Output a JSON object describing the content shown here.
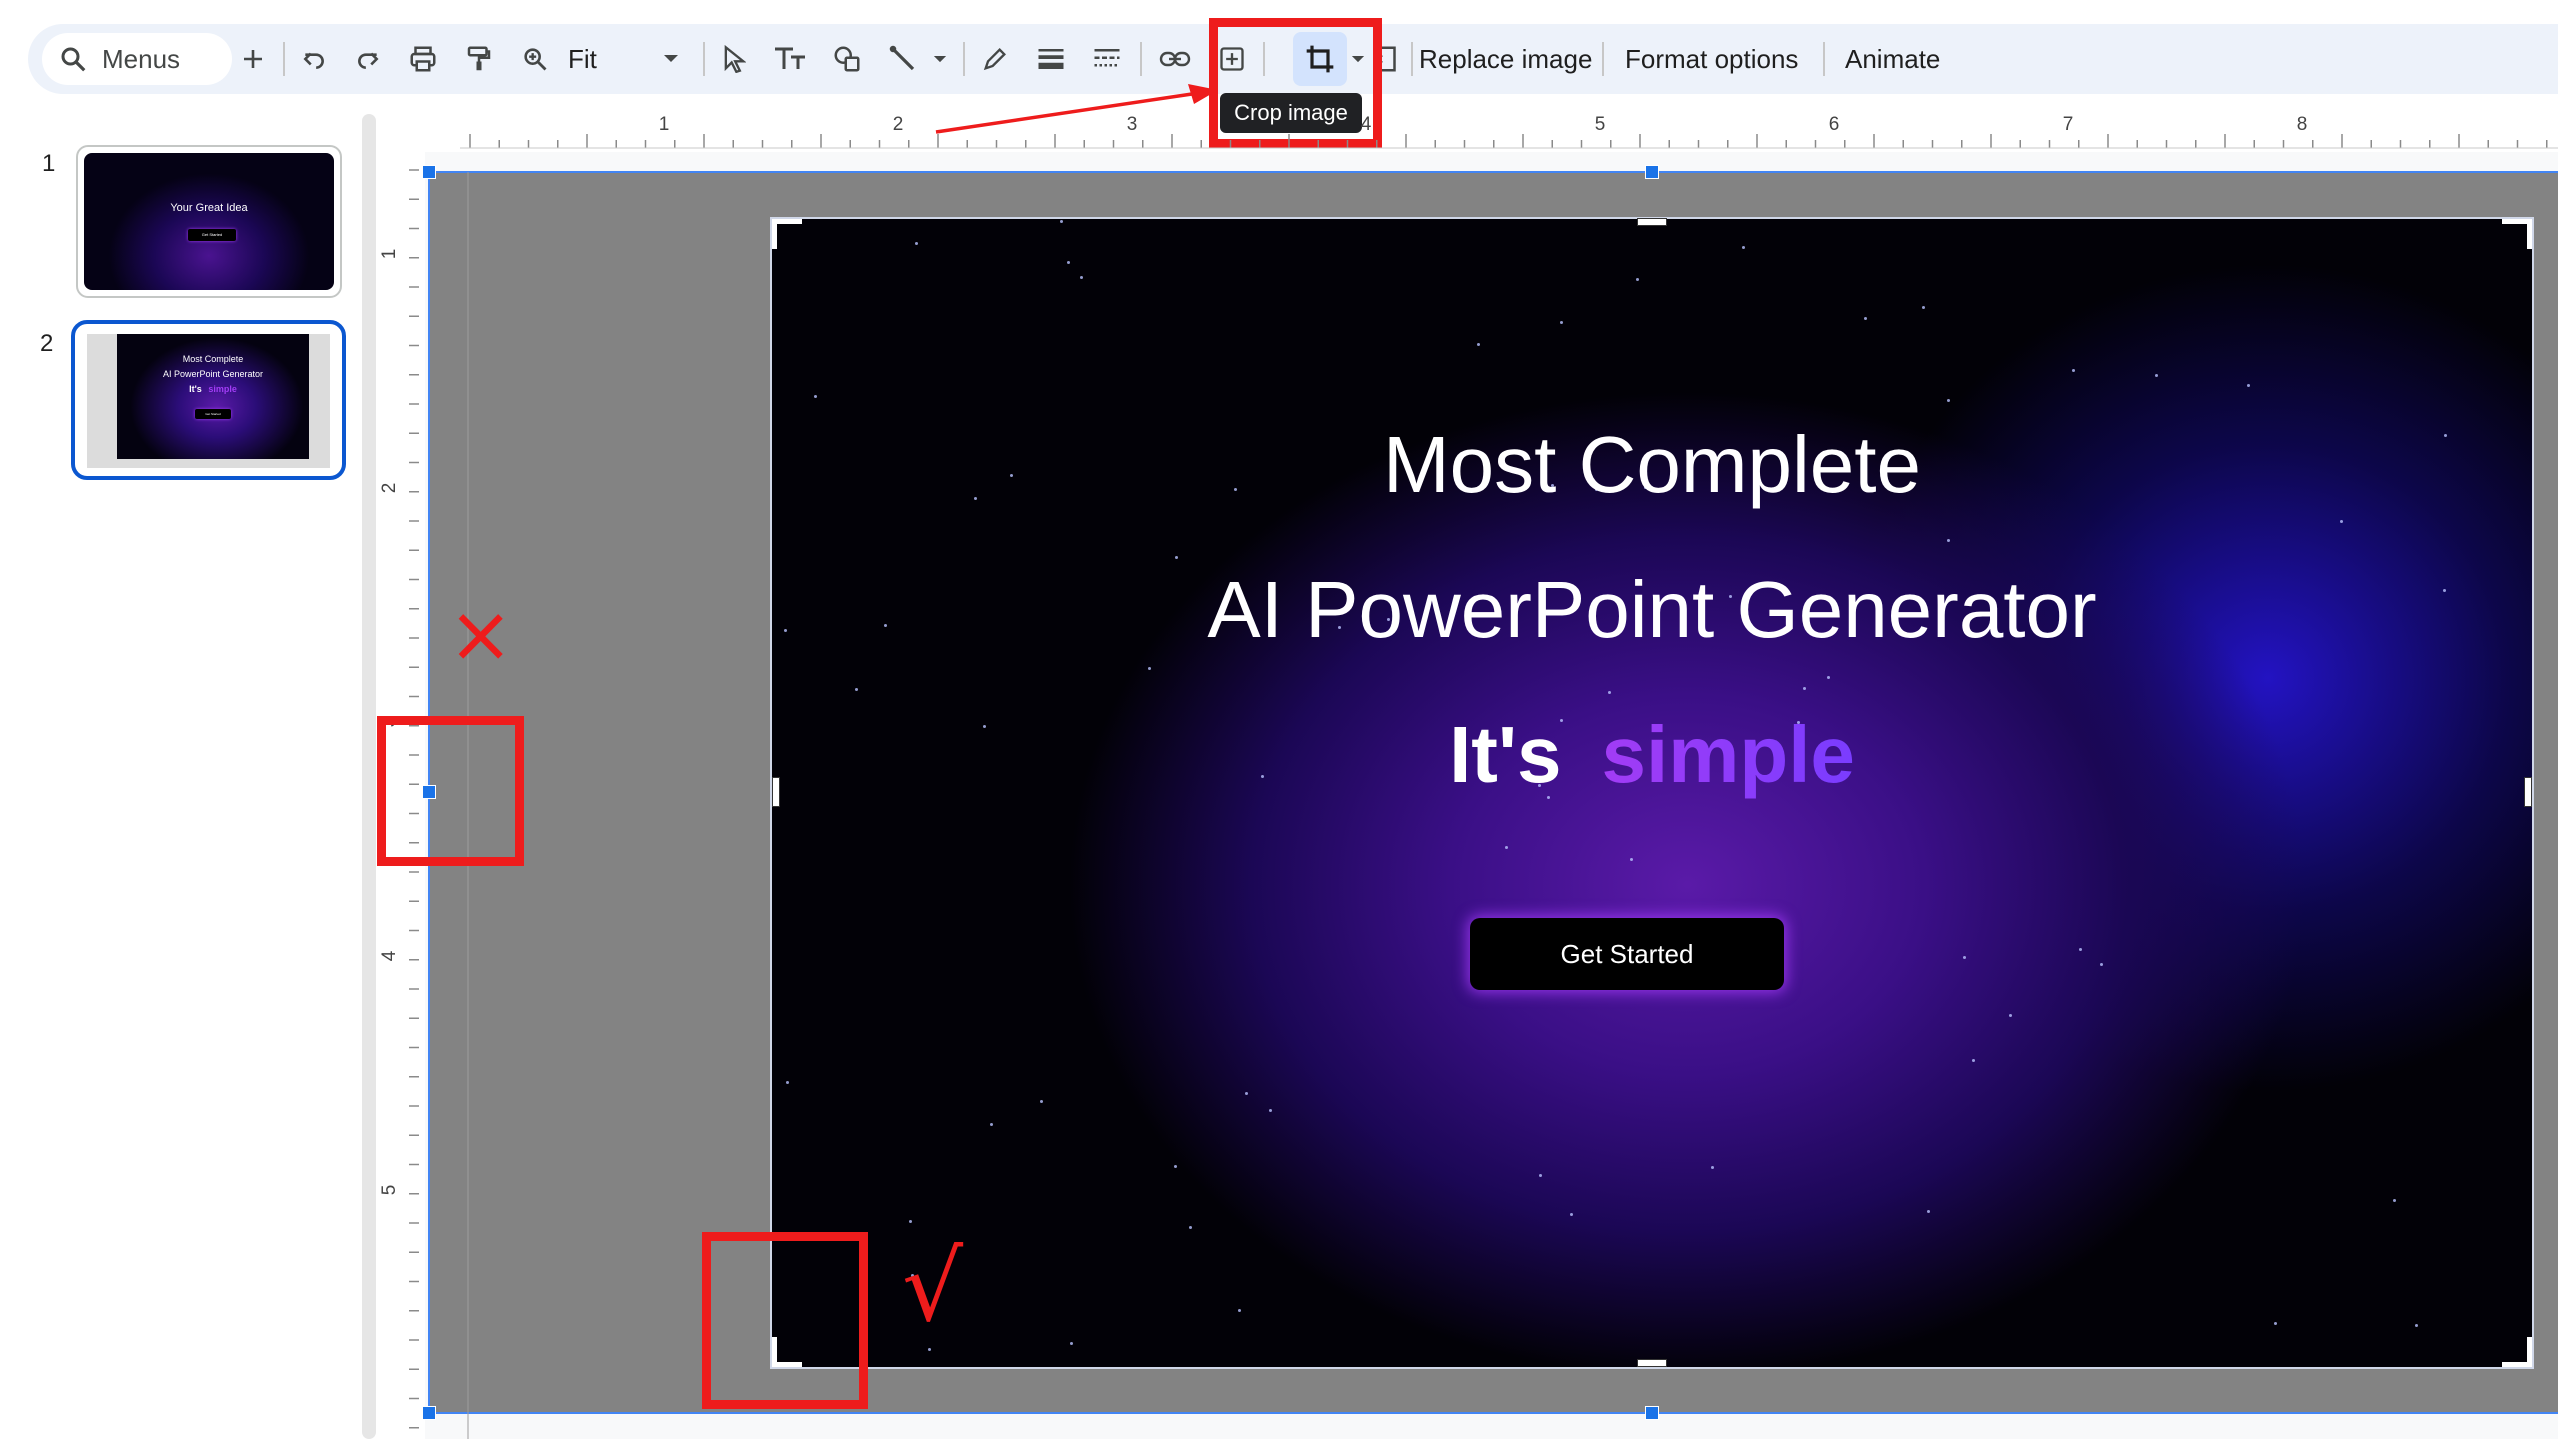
{
  "toolbar": {
    "search_label": "Menus",
    "zoom_value": "Fit",
    "replace_image_label": "Replace image",
    "format_options_label": "Format options",
    "animate_label": "Animate"
  },
  "tooltip": {
    "text": "Crop image"
  },
  "slides": [
    {
      "number": "1",
      "title": "Your Great Idea",
      "button": "Get Started"
    },
    {
      "number": "2",
      "title_line1": "Most Complete",
      "title_line2": "AI PowerPoint Generator",
      "title_line3a": "It's",
      "title_line3b": "simple",
      "button": "Get Started"
    }
  ],
  "ruler": {
    "h_labels": [
      "1",
      "2",
      "3",
      "4",
      "5",
      "6",
      "7",
      "8"
    ],
    "v_labels": [
      "1",
      "2",
      "3",
      "4",
      "5"
    ]
  },
  "slide_content": {
    "title_line1": "Most Complete",
    "title_line2": "AI PowerPoint Generator",
    "title_line3a": "It's",
    "title_line3b": "simple",
    "button_label": "Get Started"
  },
  "annotations": {
    "cross_mark": "×",
    "check_mark": "√"
  },
  "colors": {
    "toolbar_bg": "#edf2fa",
    "selection_blue": "#0b57d0",
    "annotation_red": "#ee1c1c",
    "gradient_purple": "#a23cf5"
  }
}
